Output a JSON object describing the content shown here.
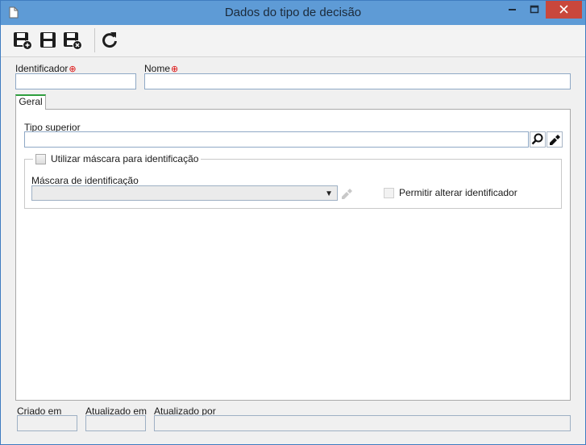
{
  "window": {
    "title": "Dados do tipo de decisão",
    "icons": {
      "document": "document-icon",
      "minimize": "minimize-icon",
      "maximize": "maximize-icon",
      "close": "close-icon"
    },
    "colors": {
      "titlebar": "#5e9bd6",
      "close": "#c9473c"
    }
  },
  "toolbar": {
    "buttons": [
      {
        "icon": "save-new-icon"
      },
      {
        "icon": "save-icon"
      },
      {
        "icon": "save-close-icon"
      },
      {
        "icon": "refresh-icon"
      }
    ]
  },
  "form": {
    "identificador_label": "Identificador",
    "identificador_value": "",
    "nome_label": "Nome",
    "nome_value": "",
    "required_mark": "⊕"
  },
  "tabs": [
    {
      "label": "Geral",
      "active": true
    }
  ],
  "geral": {
    "tipo_superior_label": "Tipo superior",
    "tipo_superior_value": "",
    "search_icon": "search-icon",
    "clear_icon": "eraser-icon",
    "usar_mascara_label": "Utilizar máscara para identificação",
    "usar_mascara_checked": false,
    "mascara_label": "Máscara de identificação",
    "mascara_value": "",
    "permitir_label": "Permitir alterar identificador",
    "permitir_checked": false
  },
  "footer": {
    "criado_em_label": "Criado em",
    "atualizado_em_label": "Atualizado em",
    "atualizado_por_label": "Atualizado por",
    "criado_em_value": "",
    "atualizado_em_value": "",
    "atualizado_por_value": ""
  }
}
